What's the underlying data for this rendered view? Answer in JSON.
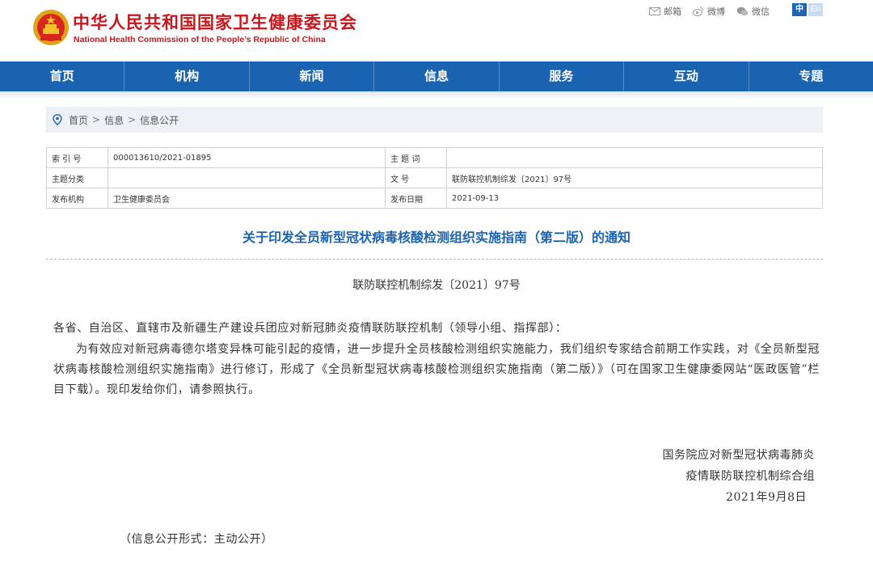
{
  "header": {
    "title_cn": "中华人民共和国国家卫生健康委员会",
    "title_en": "National Health Commission of the People’s Republic of China",
    "links": [
      {
        "label": "邮箱",
        "icon": "mail-icon"
      },
      {
        "label": "微博",
        "icon": "weibo-icon"
      },
      {
        "label": "微信",
        "icon": "wechat-icon"
      }
    ],
    "lang": {
      "zh": "中",
      "en": "En"
    }
  },
  "nav": {
    "items": [
      "首页",
      "机构",
      "新闻",
      "信息",
      "服务",
      "互动",
      "专题"
    ]
  },
  "breadcrumb": {
    "icon": "location-pin-icon",
    "items": [
      "首页",
      "信息",
      "信息公开"
    ],
    "separator": ">"
  },
  "meta": {
    "rows": [
      {
        "k1": "索 引 号",
        "v1": "000013610/2021-01895",
        "k2": "主 题 词",
        "v2": ""
      },
      {
        "k1": "主题分类",
        "v1": "",
        "k2": "文    号",
        "v2": "联防联控机制综发〔2021〕97号"
      },
      {
        "k1": "发布机构",
        "v1": "卫生健康委员会",
        "k2": "发布日期",
        "v2": "2021-09-13"
      }
    ]
  },
  "document": {
    "title": "关于印发全员新型冠状病毒核酸检测组织实施指南（第二版）的通知",
    "number": "联防联控机制综发〔2021〕97号",
    "addressee": "各省、自治区、直辖市及新疆生产建设兵团应对新冠肺炎疫情联防联控机制（领导小组、指挥部）：",
    "body": "为有效应对新冠病毒德尔塔变异株可能引起的疫情，进一步提升全员核酸检测组织实施能力，我们组织专家结合前期工作实践，对《全员新型冠状病毒核酸检测组织实施指南》进行修订，形成了《全员新型冠状病毒核酸检测组织实施指南（第二版）》（可在国家卫生健康委网站“医政医管”栏目下载）。现印发给你们，请参照执行。",
    "signature_line1": "国务院应对新型冠状病毒肺炎",
    "signature_line2": "疫情联防联控机制综合组",
    "date": "2021年9月8日",
    "disclosure": "（信息公开形式：主动公开）"
  },
  "colors": {
    "brand_red": "#c8161d",
    "nav_blue": "#1a63b0",
    "title_blue": "#1a63b0",
    "breadcrumb_bg": "#edf1f5"
  }
}
